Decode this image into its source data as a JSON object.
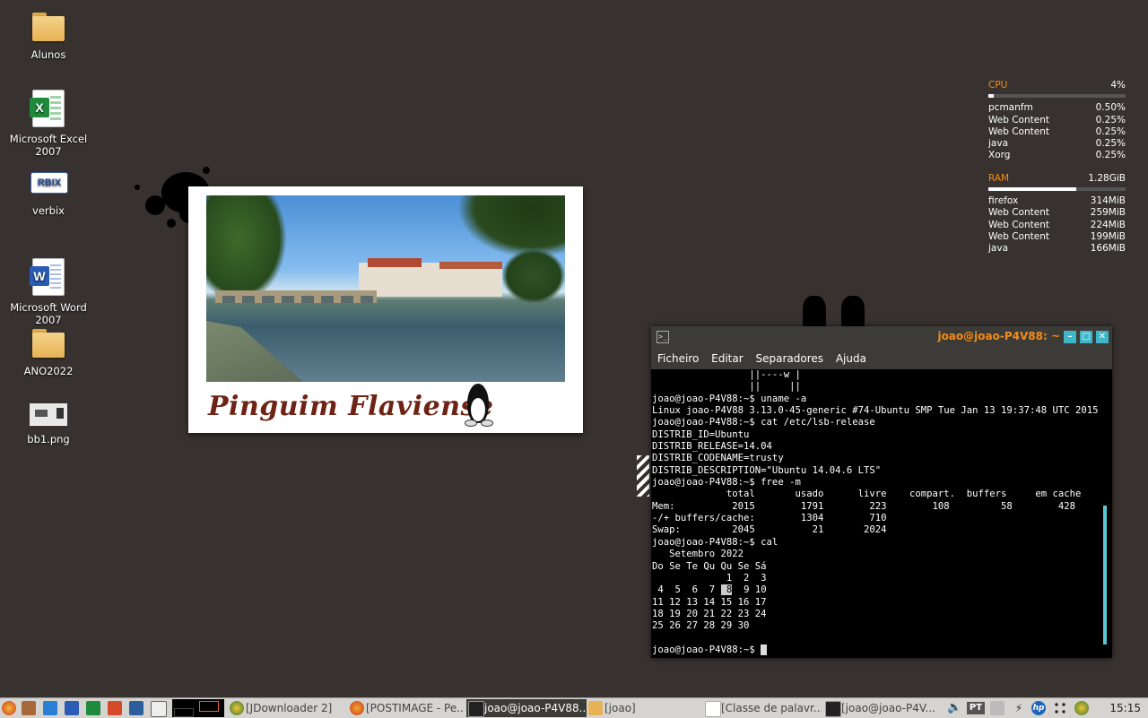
{
  "desktop": {
    "icons": [
      {
        "label": "Alunos"
      },
      {
        "label": "Microsoft Excel 2007"
      },
      {
        "label": "verbix"
      },
      {
        "label": "Microsoft Word 2007"
      },
      {
        "label": "ANO2022"
      },
      {
        "label": "bb1.png"
      }
    ],
    "wallpaper_title": "Pinguim Flaviense"
  },
  "monitor": {
    "cpu_label": "CPU",
    "cpu_value": "4%",
    "cpu_fraction": 0.04,
    "cpu_procs": [
      {
        "name": "pcmanfm",
        "value": "0.50%"
      },
      {
        "name": "Web Content",
        "value": "0.25%"
      },
      {
        "name": "Web Content",
        "value": "0.25%"
      },
      {
        "name": "java",
        "value": "0.25%"
      },
      {
        "name": "Xorg",
        "value": "0.25%"
      }
    ],
    "ram_label": "RAM",
    "ram_value": "1.28GiB",
    "ram_fraction": 0.64,
    "ram_procs": [
      {
        "name": "firefox",
        "value": "314MiB"
      },
      {
        "name": "Web Content",
        "value": "259MiB"
      },
      {
        "name": "Web Content",
        "value": "224MiB"
      },
      {
        "name": "Web Content",
        "value": "199MiB"
      },
      {
        "name": "java",
        "value": "166MiB"
      }
    ]
  },
  "terminal": {
    "title": "joao@joao-P4V88: ~",
    "menu": [
      "Ficheiro",
      "Editar",
      "Separadores",
      "Ajuda"
    ],
    "lines": [
      "                 ||----w |",
      "                 ||     ||",
      "joao@joao-P4V88:~$ uname -a",
      "Linux joao-P4V88 3.13.0-45-generic #74-Ubuntu SMP Tue Jan 13 19:37:48 UTC 2015 i",
      "joao@joao-P4V88:~$ cat /etc/lsb-release",
      "DISTRIB_ID=Ubuntu",
      "DISTRIB_RELEASE=14.04",
      "DISTRIB_CODENAME=trusty",
      "DISTRIB_DESCRIPTION=\"Ubuntu 14.04.6 LTS\"",
      "joao@joao-P4V88:~$ free -m",
      "             total       usado      livre    compart.  buffers     em cache",
      "Mem:          2015        1791        223        108         58        428",
      "-/+ buffers/cache:        1304        710",
      "Swap:         2045          21       2024",
      "joao@joao-P4V88:~$ cal",
      "   Setembro 2022",
      "Do Se Te Qu Qu Se Sá",
      "             1  2  3",
      " 4  5  6  7  8  9 10",
      "11 12 13 14 15 16 17",
      "18 19 20 21 22 23 24",
      "25 26 27 28 29 30",
      "",
      "joao@joao-P4V88:~$ "
    ],
    "highlight_day": "8"
  },
  "taskbar": {
    "tasks": [
      {
        "label": "[JDownloader 2]"
      },
      {
        "label": "[POSTIMAGE - Pe..."
      },
      {
        "label": "joao@joao-P4V88..."
      },
      {
        "label": "[joao]"
      },
      {
        "label": "[Classe de palavr..."
      },
      {
        "label": "[joao@joao-P4V..."
      }
    ],
    "lang": "PT",
    "clock": "15:15"
  }
}
